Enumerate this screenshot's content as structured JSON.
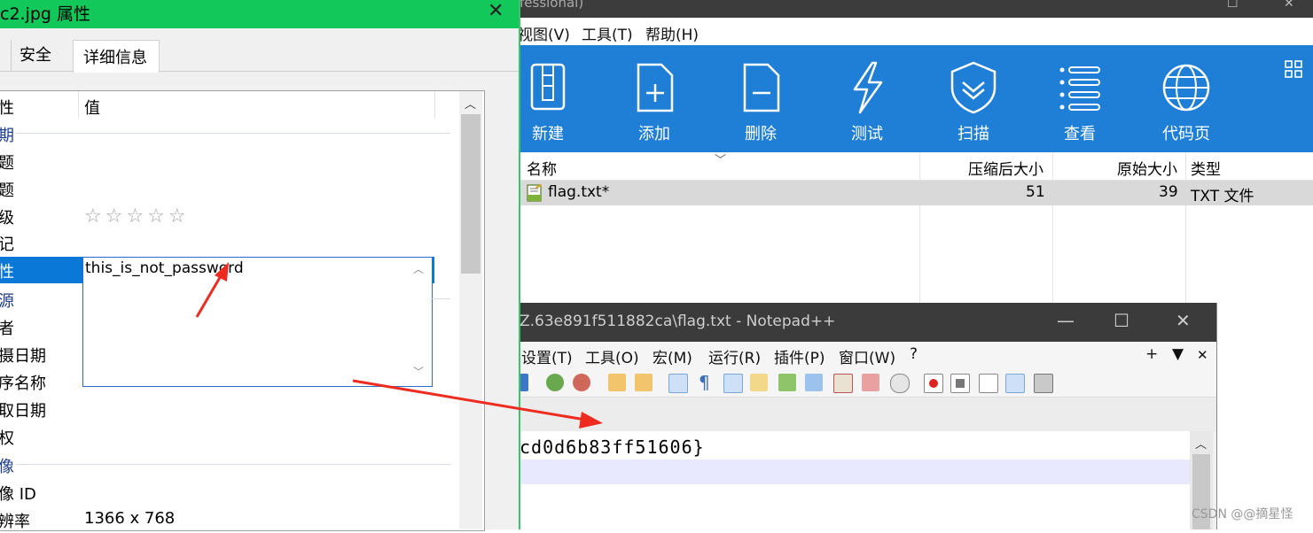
{
  "winrar": {
    "title": "fessional)",
    "menu": [
      "视图(V)",
      "工具(T)",
      "帮助(H)"
    ],
    "toolbar": [
      "新建",
      "添加",
      "删除",
      "测试",
      "扫描",
      "查看",
      "代码页"
    ],
    "columns": [
      "名称",
      "压缩后大小",
      "原始大小",
      "类型"
    ],
    "rows": [
      {
        "name": "flag.txt*",
        "packed": "51",
        "size": "39",
        "type": "TXT 文件"
      }
    ]
  },
  "notepad": {
    "title": "Z.63e891f511882ca\\flag.txt - Notepad++",
    "menu": [
      "设置(T)",
      "工具(O)",
      "宏(M)",
      "运行(R)",
      "插件(P)",
      "窗口(W)",
      "?"
    ],
    "menu_right": [
      "+",
      "▼",
      "✕"
    ],
    "content_line1": "cd0d6b83ff51606}"
  },
  "props": {
    "title": "c2.jpg 属性",
    "tabs": [
      "安全",
      "详细信息"
    ],
    "col_property": "性",
    "col_value": "值",
    "rows": [
      {
        "k": "期",
        "v": "",
        "group": true
      },
      {
        "k": "题",
        "v": ""
      },
      {
        "k": "题",
        "v": ""
      },
      {
        "k": "级",
        "v": "☆☆☆☆☆"
      },
      {
        "k": "记",
        "v": ""
      },
      {
        "k": "性",
        "v": "this_is_not_password"
      },
      {
        "k": "源",
        "v": "",
        "group": true
      },
      {
        "k": "者",
        "v": ""
      },
      {
        "k": "摄日期",
        "v": ""
      },
      {
        "k": "序名称",
        "v": ""
      },
      {
        "k": "取日期",
        "v": ""
      },
      {
        "k": "权",
        "v": ""
      },
      {
        "k": "像",
        "v": "",
        "group": true
      },
      {
        "k": "像 ID",
        "v": ""
      },
      {
        "k": "辨率",
        "v": "1366 x 768"
      }
    ]
  },
  "watermark": "CSDN @@摘星怪",
  "colors": {
    "winrar_toolbar": "#1f7fd6",
    "props_title": "#12c85a",
    "selection": "#0a78d7",
    "arrow": "#ee2b1f"
  }
}
